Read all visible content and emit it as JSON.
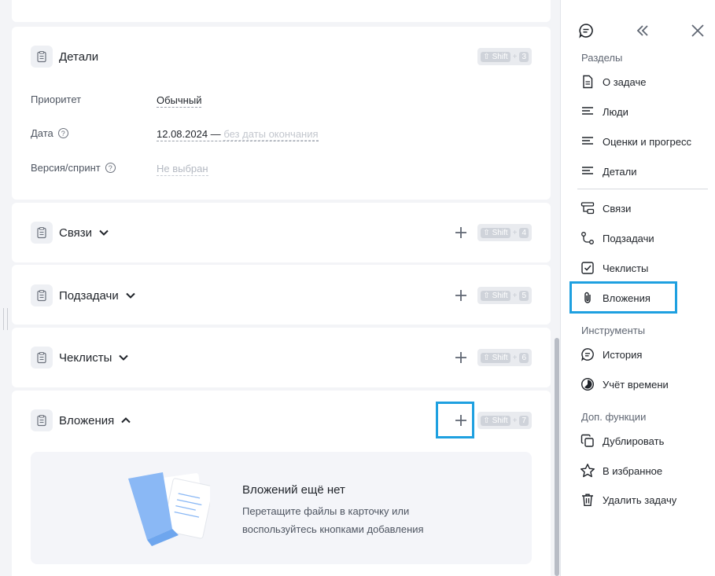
{
  "details": {
    "title": "Детали",
    "shortcut": {
      "mod": "⇧ Shift",
      "plus": "+",
      "key": "3"
    },
    "fields": [
      {
        "label": "Приоритет",
        "value": "Обычный"
      },
      {
        "label": "Дата",
        "value": "12.08.2024 —",
        "extra": "без даты окончания"
      },
      {
        "label": "Версия/спринт",
        "value": "Не выбран"
      }
    ]
  },
  "sections": [
    {
      "title": "Связи",
      "key": "4"
    },
    {
      "title": "Подзадачи",
      "key": "5"
    },
    {
      "title": "Чеклисты",
      "key": "6"
    },
    {
      "title": "Вложения",
      "key": "7"
    }
  ],
  "shortcut_mod": "⇧ Shift",
  "shortcut_plus": "+",
  "attachments": {
    "empty_title": "Вложений ещё нет",
    "empty_text": "Перетащите файлы в карточку или воспользуйтесь кнопками добавления"
  },
  "sidebar": {
    "sections_label": "Разделы",
    "tools_label": "Инструменты",
    "extra_label": "Доп. функции",
    "items": [
      {
        "label": "О задаче",
        "icon": "document-icon"
      },
      {
        "label": "Люди",
        "icon": "lines-icon"
      },
      {
        "label": "Оценки и прогресс",
        "icon": "lines-icon"
      },
      {
        "label": "Детали",
        "icon": "lines-icon"
      },
      {
        "label": "Связи",
        "icon": "links-icon"
      },
      {
        "label": "Подзадачи",
        "icon": "subtasks-icon"
      },
      {
        "label": "Чеклисты",
        "icon": "checkbox-icon"
      },
      {
        "label": "Вложения",
        "icon": "paperclip-icon"
      },
      {
        "label": "История",
        "icon": "history-icon"
      },
      {
        "label": "Учёт времени",
        "icon": "time-icon"
      },
      {
        "label": "Дублировать",
        "icon": "duplicate-icon"
      },
      {
        "label": "В избранное",
        "icon": "star-icon"
      },
      {
        "label": "Удалить задачу",
        "icon": "trash-icon"
      }
    ]
  },
  "colors": {
    "highlight": "#1ea0e0",
    "attachment_art": "#8ab8f5"
  }
}
